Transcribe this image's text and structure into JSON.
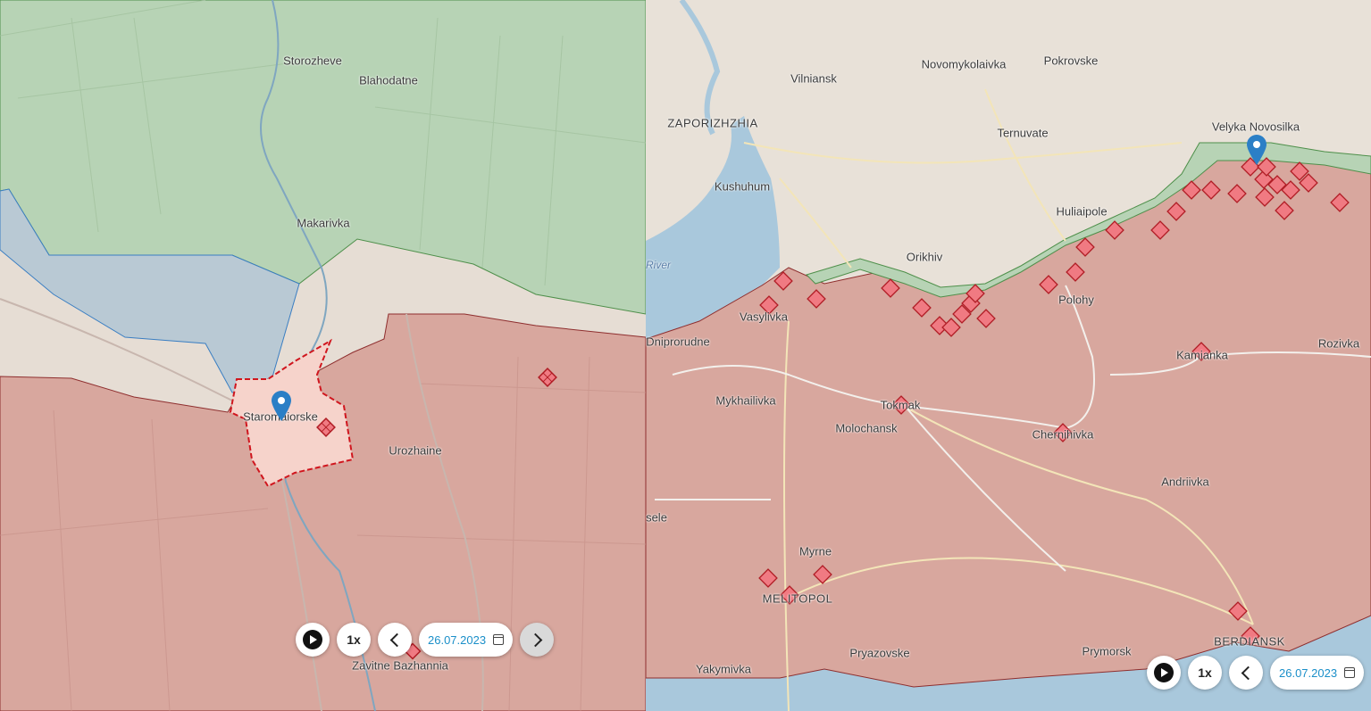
{
  "left_map": {
    "labels": {
      "storozheve": "Storozheve",
      "blahodatne": "Blahodatne",
      "makarivka": "Makarivka",
      "staromaiorske": "Staromaiorske",
      "urozhaine": "Urozhaine",
      "zavitne": "Zavitne Bazhannia"
    },
    "controls": {
      "speed": "1x",
      "date": "26.07.2023"
    }
  },
  "right_map": {
    "labels": {
      "vilniansk": "Vilniansk",
      "novomykolaivka": "Novomykolaivka",
      "pokrovske": "Pokrovske",
      "zaporizhzhia": "ZAPORIZHZHIA",
      "velyka_novosilka": "Velyka Novosilka",
      "ternuvate": "Ternuvate",
      "kushuhum": "Kushuhum",
      "huliaipole": "Huliaipole",
      "orikhiv": "Orikhiv",
      "river": "River",
      "polohy": "Polohy",
      "vasylivka": "Vasylivka",
      "dniprorudne": "Dniprorudne",
      "rozivka": "Rozivka",
      "kamianka": "Kamianka",
      "mykhailivka": "Mykhailivka",
      "tokmak": "Tokmak",
      "molochansk": "Molochansk",
      "chernihivka": "Chernihivka",
      "andriivka": "Andriivka",
      "sele": "sele",
      "myrne": "Myrne",
      "melitopol": "MELITOPOL",
      "pryazovske": "Pryazovske",
      "prymorsk": "Prymorsk",
      "berdiansk": "BERDIANSK",
      "yakymivka": "Yakymivka"
    },
    "controls": {
      "speed": "1x",
      "date": "26.07.2023"
    }
  },
  "colors": {
    "ukraine_control": "#b7d3b5",
    "russian_occupied": "#d8a79e",
    "contested": "#ead9d3",
    "land": "#e8e1d8",
    "water": "#a9c8dc",
    "marker": "#e8464f"
  }
}
